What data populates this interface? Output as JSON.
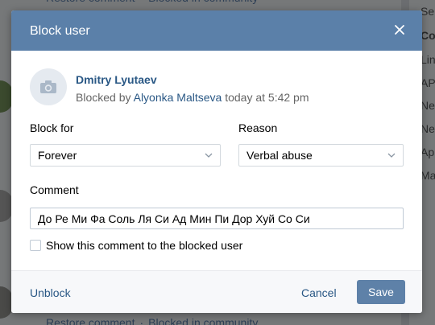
{
  "background": {
    "side_items": [
      "Se",
      "Co",
      "Lin",
      "AP",
      "Ne",
      "Ne",
      "Ap",
      "Ma"
    ],
    "restore_link": "Restore comment",
    "blocked_link": "Blocked in community",
    "separator": "·"
  },
  "modal": {
    "title": "Block user",
    "close_icon": "close-icon",
    "user": {
      "name": "Dmitry Lyutaev",
      "blocked_by_prefix": "Blocked by",
      "blocked_by_name": "Alyonka Maltseva",
      "blocked_time": "today at 5:42 pm",
      "avatar_icon": "camera-icon"
    },
    "block_for": {
      "label": "Block for",
      "value": "Forever"
    },
    "reason": {
      "label": "Reason",
      "value": "Verbal abuse"
    },
    "comment": {
      "label": "Comment",
      "value": "До  Ре  Ми  Фа  Соль Ля  Си Ад Мин Пи Дор Хуй  Со Си"
    },
    "show_comment": {
      "label": "Show this comment to the blocked user",
      "checked": false
    },
    "footer": {
      "unblock_label": "Unblock",
      "cancel_label": "Cancel",
      "save_label": "Save"
    },
    "colors": {
      "header": "#5b80a9",
      "link": "#2a5885",
      "save_button": "#5e81a8"
    }
  }
}
